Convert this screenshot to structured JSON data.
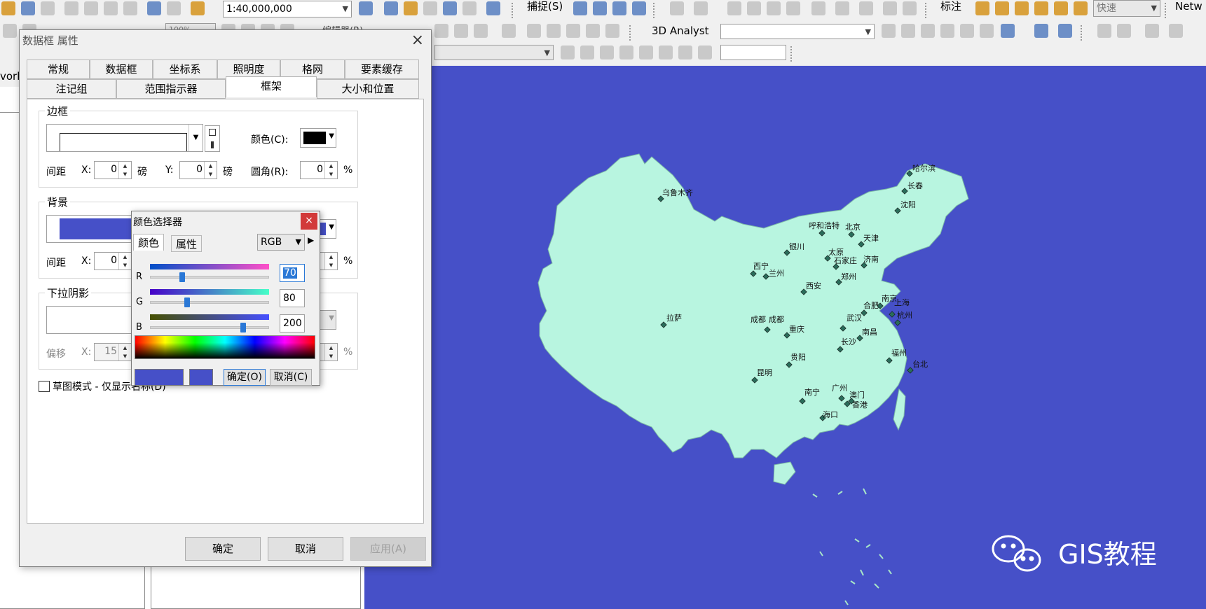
{
  "toolbar": {
    "scale_value": "1:40,000,000",
    "snap_label": "捕捉(S)",
    "label_menu": "标注",
    "quality_value": "快速",
    "network_label": "Netw",
    "editor_label": "编辑器(R)",
    "analyst_label": "3D Analyst",
    "zoom_value": "100%"
  },
  "left_pane": {
    "strip_label": "vork"
  },
  "dialog": {
    "title": "数据框 属性",
    "close_glyph": "×",
    "tabs_row1": [
      "常规",
      "数据框",
      "坐标系",
      "照明度",
      "格网",
      "要素缓存"
    ],
    "tabs_row2": [
      "注记组",
      "范围指示器",
      "框架",
      "大小和位置"
    ],
    "active_tab": "框架",
    "border": {
      "title": "边框",
      "color_label": "颜色(C):",
      "color": "#000000",
      "gap_label": "间距",
      "x_label": "X:",
      "x_value": "0",
      "y_label": "Y:",
      "y_value": "0",
      "unit": "磅",
      "radius_label": "圆角(R):",
      "radius_value": "0",
      "percent": "%"
    },
    "background": {
      "title": "背景",
      "color": "#4650c8",
      "gap_label": "间距",
      "x_label": "X:",
      "x_value": "0",
      "percent": "%"
    },
    "shadow": {
      "title": "下拉阴影",
      "offset_label": "偏移",
      "x_label": "X:",
      "x_value": "15",
      "percent": "%"
    },
    "draft_mode_label": "草图模式 - 仅显示名称(D)",
    "ok_label": "确定",
    "cancel_label": "取消",
    "apply_label": "应用(A)"
  },
  "color_picker": {
    "title": "颜色选择器",
    "close_glyph": "×",
    "tab_color": "颜色",
    "tab_properties": "属性",
    "mode": "RGB",
    "r_label": "R",
    "r_value": "70",
    "g_label": "G",
    "g_value": "80",
    "b_label": "B",
    "b_value": "200",
    "r_fraction": 0.27,
    "g_fraction": 0.31,
    "b_fraction": 0.78,
    "new_color": "#4650c8",
    "old_color": "#4650c8",
    "ok_label": "确定(O)",
    "cancel_label": "取消(C)"
  },
  "map": {
    "background_color": "#4650c8",
    "land_color": "#b8f5e0",
    "cities": [
      "乌鲁木齐",
      "哈尔滨",
      "长春",
      "沈阳",
      "呼和浩特",
      "北京",
      "天津",
      "银川",
      "太原",
      "石家庄",
      "济南",
      "西宁",
      "兰州",
      "郑州",
      "西安",
      "南京",
      "上海",
      "合肥",
      "拉萨",
      "成都",
      "成都",
      "重庆",
      "武汉",
      "杭州",
      "南昌",
      "长沙",
      "福州",
      "台北",
      "贵阳",
      "昆明",
      "南宁",
      "广州",
      "澳门",
      "香港",
      "海口"
    ]
  },
  "watermark": {
    "text": "GIS教程"
  }
}
